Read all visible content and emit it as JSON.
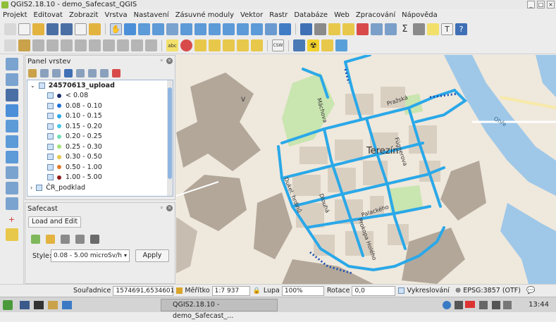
{
  "window": {
    "title": "QGIS2.18.10 - demo_Safecast_QGIS",
    "minimize": "_",
    "maximize": "□",
    "close": "×"
  },
  "menu": [
    "Projekt",
    "Editovat",
    "Zobrazit",
    "Vrstva",
    "Nastavení",
    "Zásuvné moduly",
    "Vektor",
    "Rastr",
    "Databáze",
    "Web",
    "Zpracování",
    "Nápověda"
  ],
  "layers_panel": {
    "title": "Panel vrstev",
    "layer_name": "24570613_upload",
    "legend": [
      {
        "label": "< 0.08",
        "color": "#1a2c6b"
      },
      {
        "label": "0.08 - 0.10",
        "color": "#1d6fd8"
      },
      {
        "label": "0.10 - 0.15",
        "color": "#2aa8e8"
      },
      {
        "label": "0.15 - 0.20",
        "color": "#47c6e6"
      },
      {
        "label": "0.20 - 0.25",
        "color": "#6fdfb8"
      },
      {
        "label": "0.25 - 0.30",
        "color": "#a5e27a"
      },
      {
        "label": "0.30 - 0.50",
        "color": "#e8c84a"
      },
      {
        "label": "0.50 - 1.00",
        "color": "#e07a2a"
      },
      {
        "label": "1.00 - 5.00",
        "color": "#8a1a1a"
      }
    ],
    "basemap_layer": "ČR_podklad"
  },
  "safecast_panel": {
    "title": "Safecast",
    "tab": "Load and Edit",
    "style_label": "Style:",
    "style_value": "0.08 - 5.00 microSv/h",
    "apply": "Apply"
  },
  "map": {
    "labels": {
      "v": "V",
      "prazska": "Pražská",
      "machova": "Máchova",
      "terezin": "Terezín",
      "fugnerova": "Fügnerova",
      "dlouha": "Dlouhá",
      "dukel": "Dukel. hrdinů",
      "palackeho": "Palackého",
      "prokopa": "Prokopa Holého",
      "ohre": "Ohře"
    },
    "colors": {
      "river": "#9fc8e8",
      "green": "#c9e5b0",
      "block": "#d9cfc1",
      "fort": "#b3a79a",
      "track": "#2aa8e8"
    }
  },
  "status": {
    "coords_label": "Souřadnice",
    "coords_value": "1574691,6534601",
    "scale_label": "Měřítko",
    "scale_value": "1:7 937",
    "zoom_label": "Lupa",
    "zoom_value": "100%",
    "rotation_label": "Rotace",
    "rotation_value": "0,0",
    "render_label": "Vykreslování",
    "crs": "EPSG:3857 (OTF)"
  },
  "taskbar": {
    "task": "QGIS2.18.10 - demo_Safecast_...",
    "time": "13:44"
  }
}
